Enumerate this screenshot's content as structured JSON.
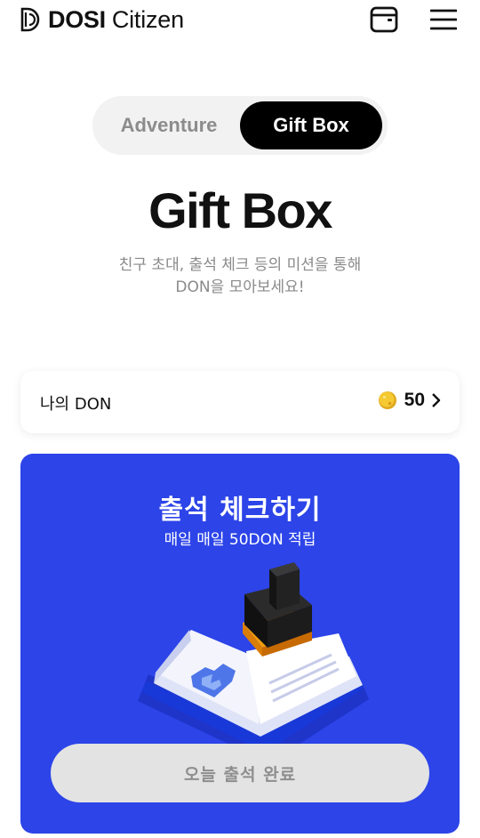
{
  "header": {
    "brand": "DOSI",
    "brand_sub": "Citizen",
    "wallet_icon": "wallet-icon",
    "menu_icon": "hamburger-menu-icon"
  },
  "tabs": [
    {
      "label": "Adventure",
      "selected": false
    },
    {
      "label": "Gift Box",
      "selected": true
    }
  ],
  "page": {
    "title": "Gift Box",
    "subtitle_line1": "친구 초대, 출석 체크 등의 미션을 통해",
    "subtitle_line2": "DON을 모아보세요!"
  },
  "my_don": {
    "label": "나의 DON",
    "value": "50",
    "coin_icon": "coin-icon",
    "chevron_icon": "chevron-right-icon"
  },
  "attendance": {
    "title": "출석 체크하기",
    "subtitle": "매일 매일 50DON 적립",
    "button_label": "오늘 출석 완료",
    "illustration": "stamp-book-illustration"
  },
  "colors": {
    "accent_blue": "#2c44e8",
    "tab_selected_bg": "#000000",
    "button_disabled_bg": "#e3e3e3",
    "coin_gold": "#f2c12e"
  }
}
